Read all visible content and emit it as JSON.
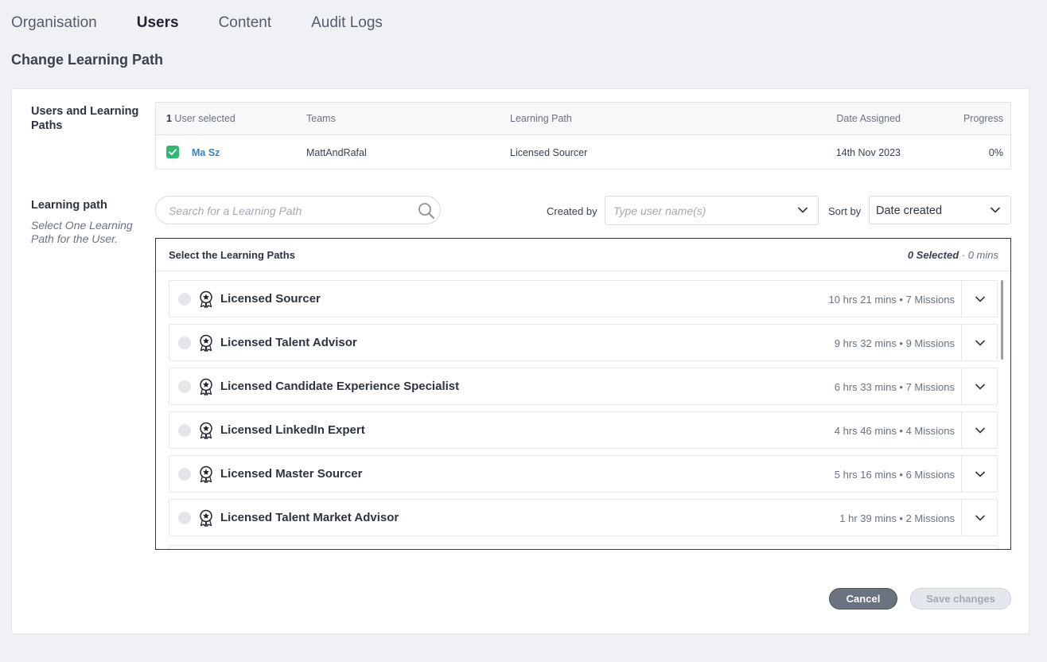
{
  "nav": {
    "tabs": [
      {
        "label": "Organisation"
      },
      {
        "label": "Users"
      },
      {
        "label": "Content"
      },
      {
        "label": "Audit Logs"
      }
    ]
  },
  "page": {
    "title": "Change Learning Path"
  },
  "users_section": {
    "label": "Users and Learning Paths",
    "selected_count": "1",
    "selected_suffix": " User selected",
    "columns": [
      "Teams",
      "Learning Path",
      "Date Assigned",
      "Progress"
    ],
    "rows": [
      {
        "name": "Ma Sz",
        "team": "MattAndRafal",
        "learning_path": "Licensed Sourcer",
        "date_assigned": "14th Nov 2023",
        "progress": "0%",
        "checked": true
      }
    ]
  },
  "lp_section": {
    "label": "Learning path",
    "sublabel": "Select One Learning Path for the User.",
    "search_placeholder": "Search for a Learning Path",
    "created_by_label": "Created by",
    "created_by_placeholder": "Type user name(s)",
    "sort_by_label": "Sort by",
    "sort_by_value": "Date created",
    "box_title": "Select the Learning Paths",
    "selected_summary": "0 Selected",
    "selected_mins": " · 0 mins",
    "items": [
      {
        "name": "Licensed Sourcer",
        "meta": "10 hrs 21 mins • 7 Missions"
      },
      {
        "name": "Licensed Talent Advisor",
        "meta": "9 hrs 32 mins • 9 Missions"
      },
      {
        "name": "Licensed Candidate Experience Specialist",
        "meta": "6 hrs 33 mins • 7 Missions"
      },
      {
        "name": "Licensed LinkedIn Expert",
        "meta": "4 hrs 46 mins • 4 Missions"
      },
      {
        "name": "Licensed Master Sourcer",
        "meta": "5 hrs 16 mins • 6 Missions"
      },
      {
        "name": "Licensed Talent Market Advisor",
        "meta": "1 hr 39 mins • 2 Missions"
      }
    ]
  },
  "actions": {
    "cancel": "Cancel",
    "save": "Save changes"
  },
  "colors": {
    "accent_green": "#2eb872",
    "link_blue": "#3b82c4",
    "cancel_bg": "#6b7280"
  },
  "icons": {
    "search": "search-icon",
    "chevron": "chevron-down-icon",
    "badge": "certificate-badge-icon",
    "check": "checkmark-icon"
  }
}
